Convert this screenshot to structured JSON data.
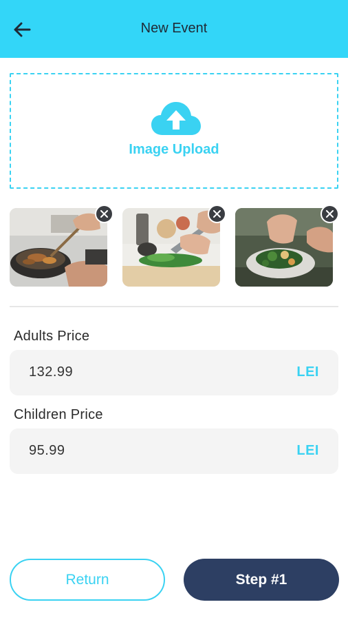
{
  "header": {
    "title": "New Event",
    "back_icon": "arrow-left-icon",
    "background": "#33d6f8"
  },
  "upload": {
    "label": "Image Upload",
    "icon": "cloud-upload-icon",
    "accent": "#3ad2f2"
  },
  "images": [
    {
      "name": "cooking-pan-photo",
      "remove_icon": "close-icon"
    },
    {
      "name": "cutting-vegetables-photo",
      "remove_icon": "close-icon"
    },
    {
      "name": "plated-food-photo",
      "remove_icon": "close-icon"
    }
  ],
  "adults": {
    "label": "Adults Price",
    "value": "132.99",
    "currency": "LEI"
  },
  "children": {
    "label": "Children Price",
    "value": "95.99",
    "currency": "LEI"
  },
  "footer": {
    "return_label": "Return",
    "step_label": "Step #1",
    "step_color": "#2d3f63"
  }
}
